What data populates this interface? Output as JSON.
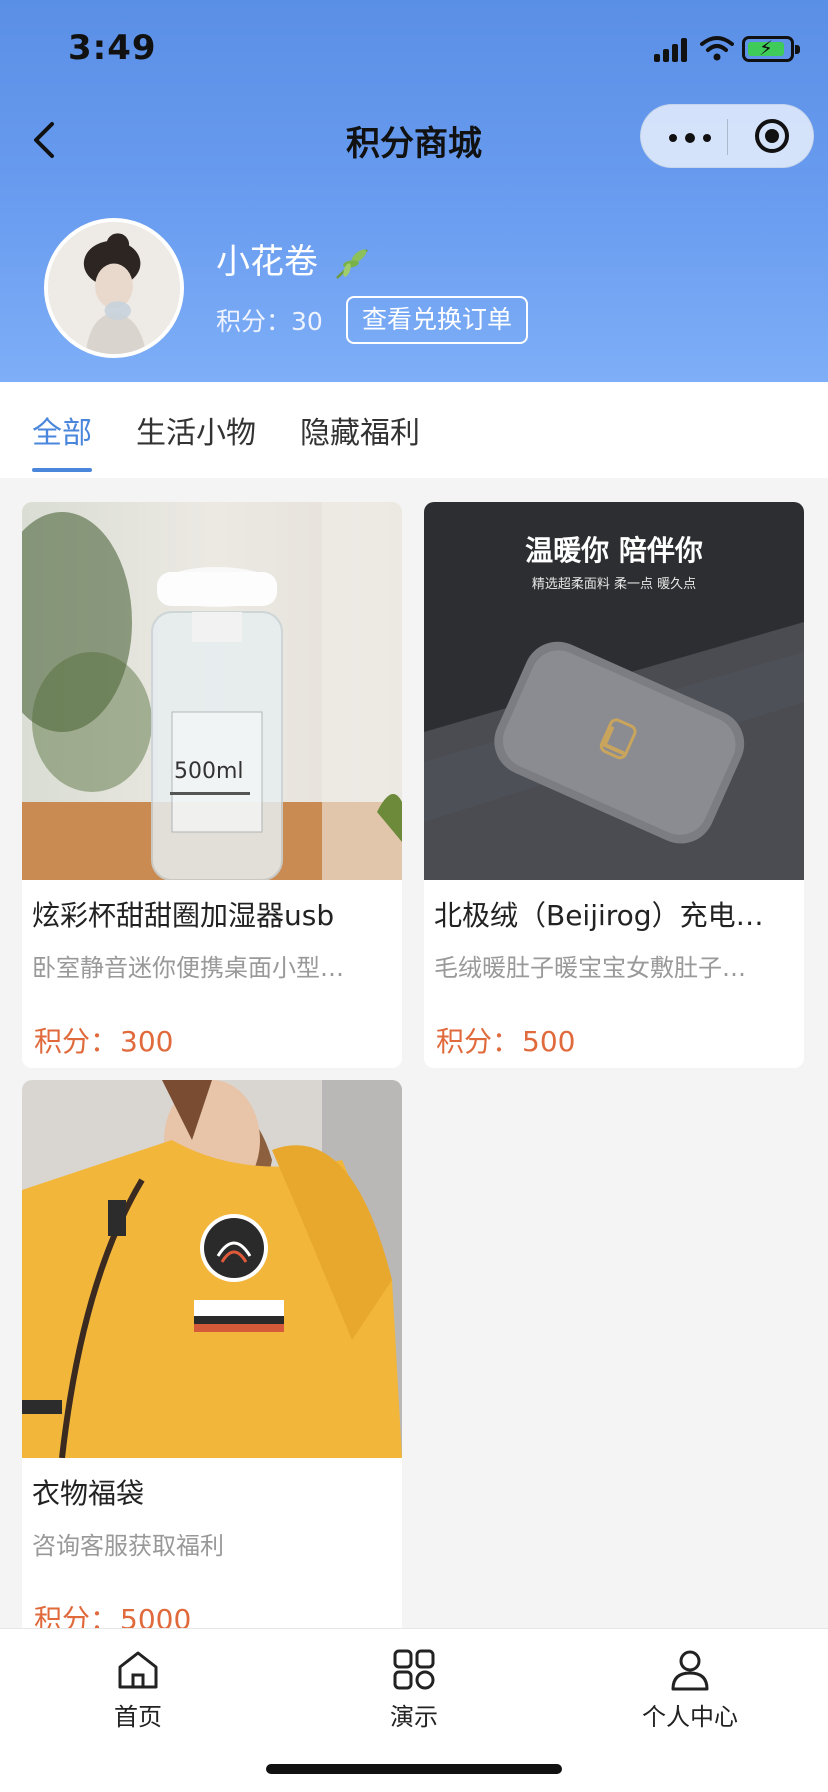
{
  "status_bar": {
    "time": "3:49"
  },
  "navbar": {
    "title": "积分商城"
  },
  "profile": {
    "name": "小花卷",
    "points_label": "积分：",
    "points_value": "30",
    "order_button": "查看兑换订单"
  },
  "tabs": [
    {
      "label": "全部",
      "active": true
    },
    {
      "label": "生活小物",
      "active": false
    },
    {
      "label": "隐藏福利",
      "active": false
    }
  ],
  "products": [
    {
      "title": "炫彩杯甜甜圈加湿器usb",
      "desc": "卧室静音迷你便携桌面小型…",
      "price_label": "积分：",
      "price": "300",
      "image_text": "500ml"
    },
    {
      "title": "北极绒（Beijirog）充电…",
      "desc": "毛绒暖肚子暖宝宝女敷肚子…",
      "price_label": "积分：",
      "price": "500",
      "image_headline": "温暖你 陪伴你",
      "image_subline": "精选超柔面料 柔一点 暖久点"
    },
    {
      "title": "衣物福袋",
      "desc": "咨询客服获取福利",
      "price_label": "积分：",
      "price": "5000"
    }
  ],
  "tabbar": [
    {
      "label": "首页",
      "icon": "home-icon"
    },
    {
      "label": "演示",
      "icon": "grid-icon"
    },
    {
      "label": "个人中心",
      "icon": "person-icon"
    }
  ]
}
